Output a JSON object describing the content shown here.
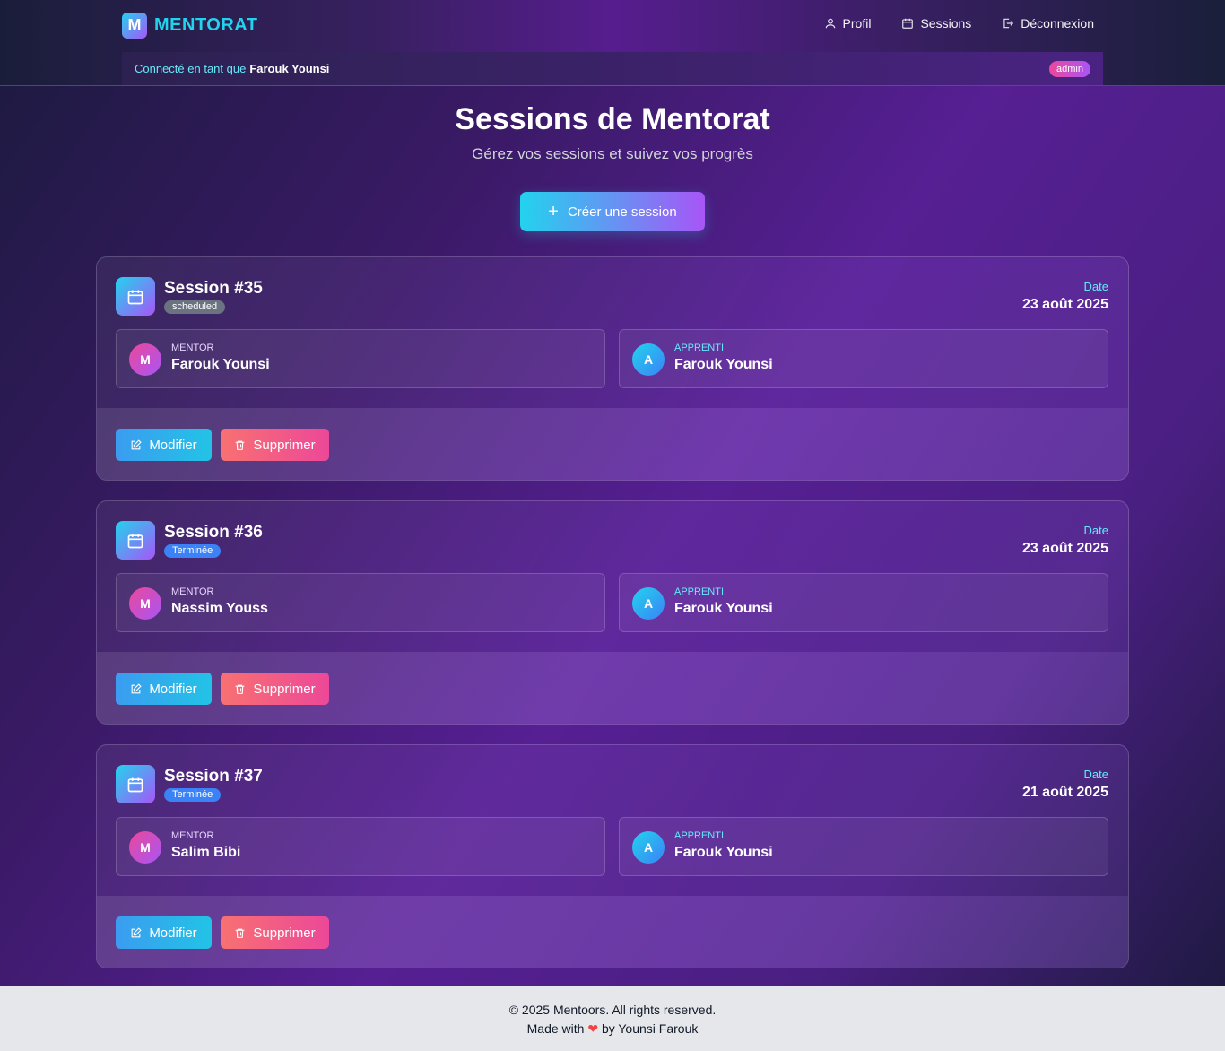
{
  "brand": {
    "logo_letter": "M",
    "name": "MENTORAT"
  },
  "nav": [
    {
      "label": "Profil",
      "icon": "user-icon"
    },
    {
      "label": "Sessions",
      "icon": "calendar-icon"
    },
    {
      "label": "Déconnexion",
      "icon": "logout-icon"
    }
  ],
  "userbar": {
    "connected_label": "Connecté en tant que",
    "user_name": "Farouk Younsi",
    "role": "admin"
  },
  "page": {
    "title": "Sessions de Mentorat",
    "subtitle": "Gérez vos sessions et suivez vos progrès",
    "create_button": "Créer une session"
  },
  "labels": {
    "date": "Date",
    "mentor": "MENTOR",
    "apprenti": "APPRENTI",
    "edit": "Modifier",
    "delete": "Supprimer"
  },
  "sessions": [
    {
      "title": "Session #35",
      "status": "scheduled",
      "status_color": "#6b7280",
      "date": "23 août 2025",
      "mentor_initial": "M",
      "mentor_name": "Farouk Younsi",
      "apprenti_initial": "A",
      "apprenti_name": "Farouk Younsi"
    },
    {
      "title": "Session #36",
      "status": "Terminée",
      "status_color": "#3b82f6",
      "date": "23 août 2025",
      "mentor_initial": "M",
      "mentor_name": "Nassim Youss",
      "apprenti_initial": "A",
      "apprenti_name": "Farouk Younsi"
    },
    {
      "title": "Session #37",
      "status": "Terminée",
      "status_color": "#3b82f6",
      "date": "21 août 2025",
      "mentor_initial": "M",
      "mentor_name": "Salim Bibi",
      "apprenti_initial": "A",
      "apprenti_name": "Farouk Younsi"
    }
  ],
  "footer": {
    "copyright": "© 2025 Mentoors. All rights reserved.",
    "made_with": "Made with",
    "heart": "❤",
    "by": "by Younsi Farouk"
  },
  "colors": {
    "accent_cyan": "#22d3ee",
    "accent_purple": "#a855f7",
    "danger": "#f87171"
  }
}
